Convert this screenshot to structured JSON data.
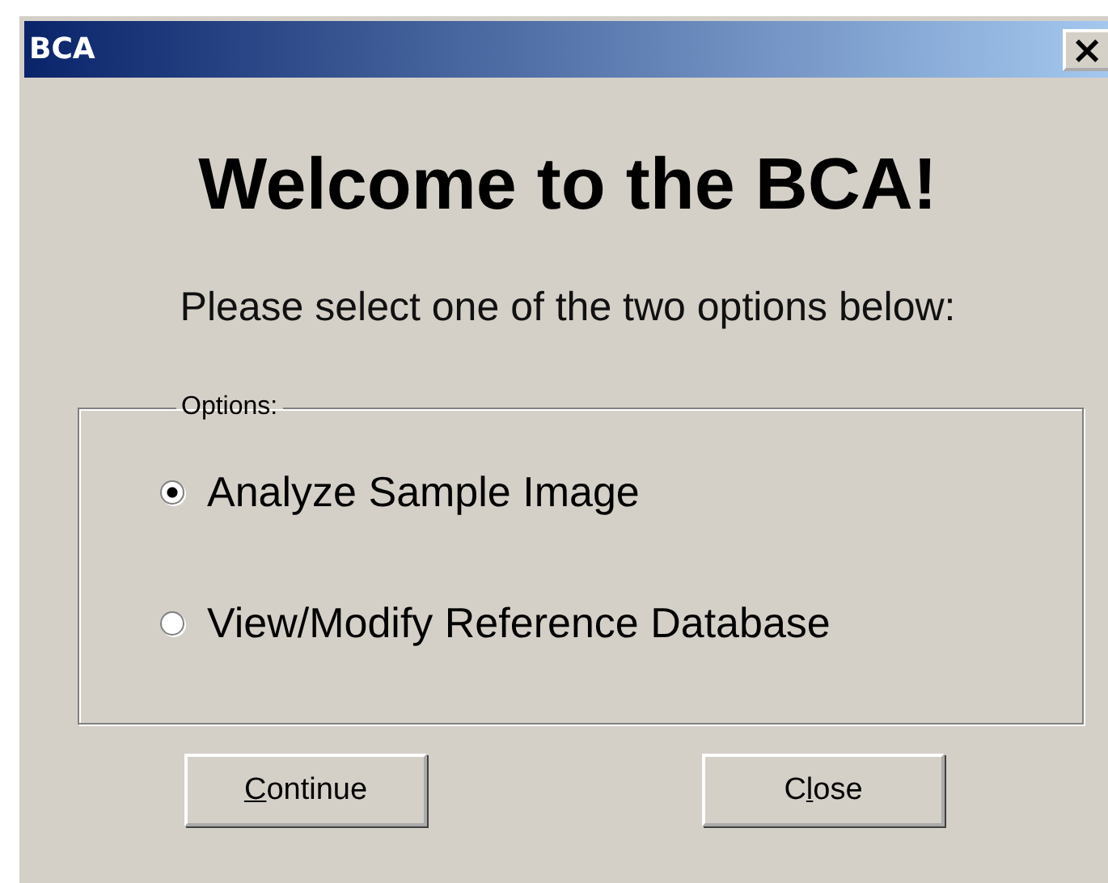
{
  "window": {
    "title": "BCA",
    "close_glyph": "×"
  },
  "heading": "Welcome to the BCA!",
  "prompt": "Please select one of the two options below:",
  "options_group": {
    "legend": "Options:",
    "items": [
      {
        "label": "Analyze Sample Image",
        "selected": true
      },
      {
        "label": "View/Modify Reference Database",
        "selected": false
      }
    ]
  },
  "buttons": [
    {
      "key": "C",
      "after": "ontinue"
    },
    {
      "before": "C",
      "key": "l",
      "after": "ose"
    }
  ]
}
